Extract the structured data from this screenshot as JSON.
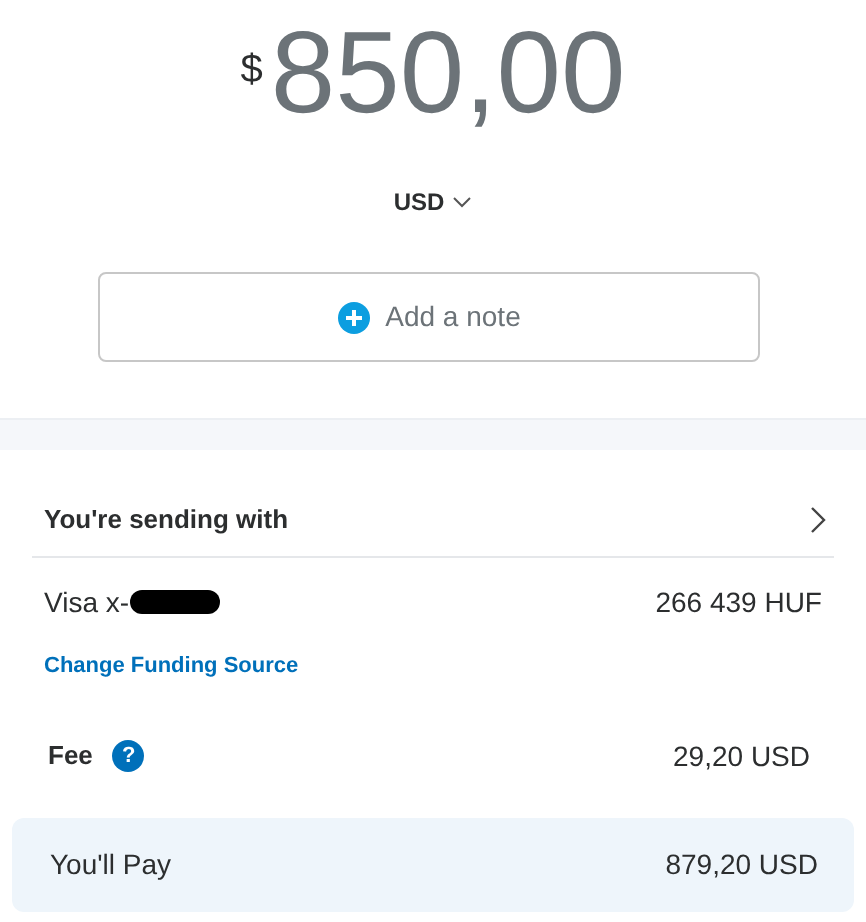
{
  "amount": {
    "currency_symbol": "$",
    "value": "850,00"
  },
  "currency_selector": {
    "label": "USD"
  },
  "note_button": {
    "label": "Add a note"
  },
  "funding": {
    "heading": "You're sending with",
    "source_label": "Visa x-",
    "source_amount": "266 439 HUF",
    "change_link": "Change Funding Source"
  },
  "fee": {
    "label": "Fee",
    "help_glyph": "?",
    "amount": "29,20 USD"
  },
  "total": {
    "label": "You'll Pay",
    "amount": "879,20 USD"
  }
}
